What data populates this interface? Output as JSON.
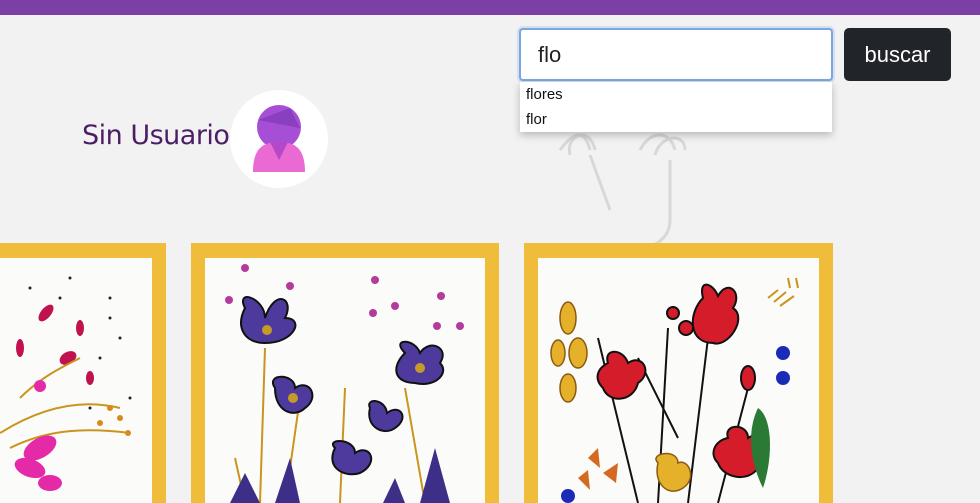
{
  "search": {
    "value": "flo",
    "button_label": "buscar",
    "suggestions": [
      "flores",
      "flor"
    ]
  },
  "user": {
    "name": "Sin Usuario",
    "avatar_icon": "user-avatar-icon"
  },
  "colors": {
    "top_bar": "#7b3fa6",
    "card_frame": "#f0bd3a",
    "button": "#212529",
    "user_name": "#4b1f66"
  },
  "gallery": {
    "cards": [
      {
        "art": "flower-painting-magenta"
      },
      {
        "art": "flower-painting-purple"
      },
      {
        "art": "flower-painting-red"
      }
    ]
  }
}
